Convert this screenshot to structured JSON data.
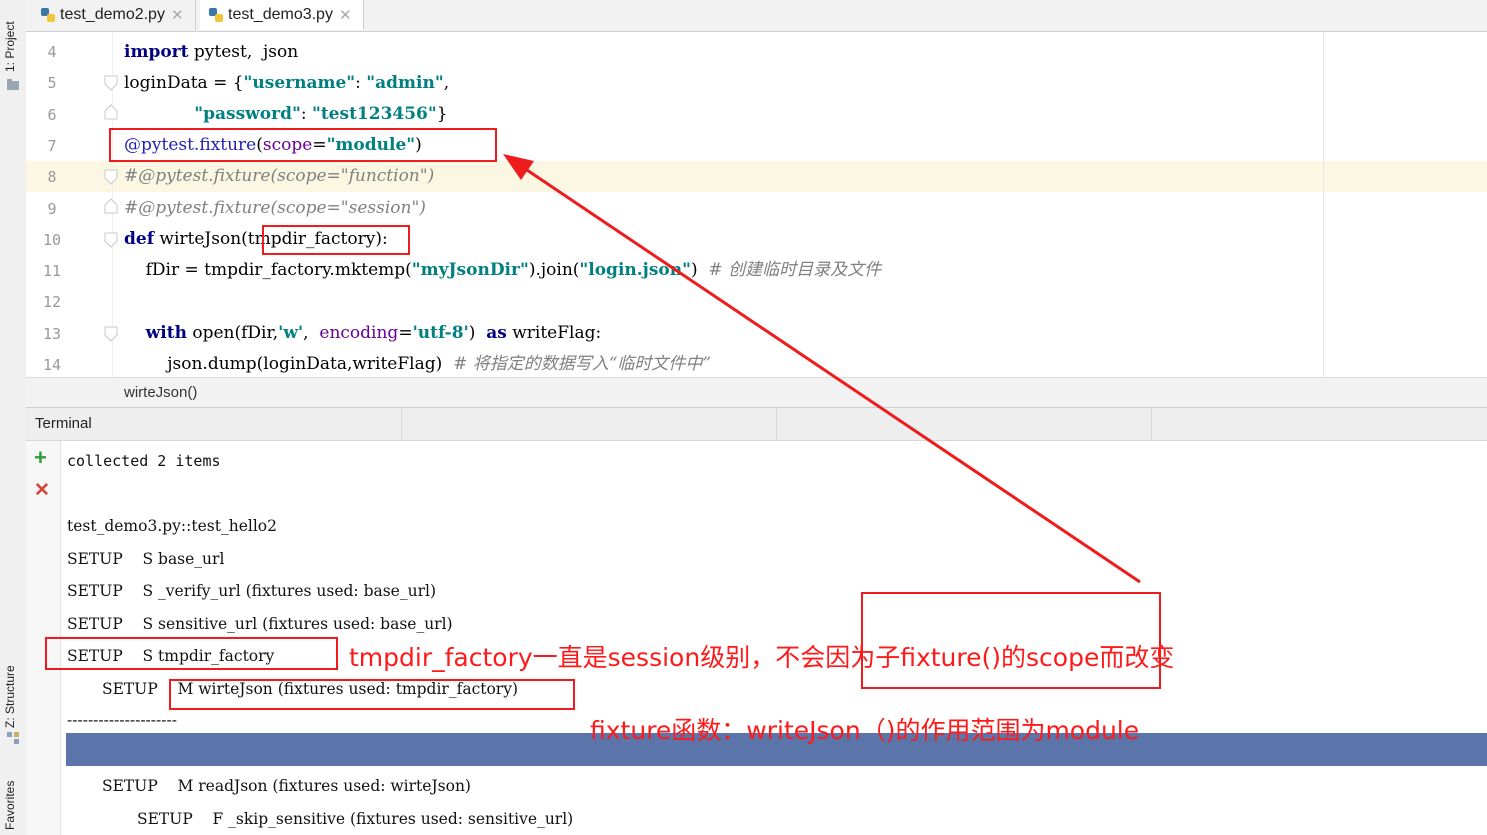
{
  "left_strip": {
    "project_tab": "1: Project",
    "structure_tab": "Z: Structure",
    "favorites_tab": "Favorites"
  },
  "tabs": [
    {
      "label": "test_demo2.py",
      "active": false
    },
    {
      "label": "test_demo3.py",
      "active": true
    }
  ],
  "editor": {
    "line_numbers": [
      "4",
      "5",
      "6",
      "7",
      "8",
      "9",
      "10",
      "11",
      "12",
      "13",
      "14"
    ],
    "lines": {
      "l4": {
        "kw": "import",
        "rest": " pytest,  json"
      },
      "l5": {
        "a": "loginData = {",
        "key": "\"username\"",
        "b": ": ",
        "val": "\"admin\"",
        "c": ","
      },
      "l6": {
        "indent": "             ",
        "key": "\"password\"",
        "b": ": ",
        "val": "\"test123456\"",
        "c": "}"
      },
      "l7": {
        "dec": "@pytest.fixture",
        "p1": "(",
        "prm": "scope",
        "eq": "=",
        "val": "\"module\"",
        "p2": ")"
      },
      "l8": "#@pytest.fixture(scope=\"function\")",
      "l9": "#@pytest.fixture(scope=\"session\")",
      "l10": {
        "kw": "def",
        "name": " wirteJson(",
        "arg": "tmpdir_factory",
        "end": "):"
      },
      "l11": {
        "a": "    fDir = tmpdir_factory.mktemp(",
        "s1": "\"myJsonDir\"",
        "b": ").join(",
        "s2": "\"login.json\"",
        "c": ")  ",
        "cmt": "# 创建临时目录及文件"
      },
      "l13": {
        "indent": "    ",
        "kw": "with",
        "a": " open(fDir,",
        "s1": "'w'",
        "b": ",  ",
        "prm": "encoding",
        "eq": "=",
        "s2": "'utf-8'",
        "c": ")  ",
        "kw2": "as",
        "d": " writeFlag:"
      },
      "l14": {
        "a": "        json.dump(loginData,writeFlag)  ",
        "cmt": "# 将指定的数据写入“临时文件中”"
      }
    },
    "breadcrumb": "wirteJson()"
  },
  "terminal": {
    "title": "Terminal",
    "add_icon": "+",
    "close_icon": "✕",
    "lines": [
      "collected 2 items",
      "test_demo3.py::test_hello2",
      "SETUP    S base_url",
      "SETUP    S _verify_url (fixtures used: base_url)",
      "SETUP    S sensitive_url (fixtures used: base_url)",
      "SETUP    S tmpdir_factory",
      "SETUP    M wirteJson (fixtures used: tmpdir_factory)",
      "---------------------",
      "SETUP    M readJson (fixtures used: wirteJson)",
      "SETUP    F _skip_sensitive (fixtures used: sensitive_url)"
    ]
  },
  "annotations": {
    "note1": "tmpdir_factory一直是session级别，不会因为子fixture()的scope而改变",
    "note2": "fixture函数：writeJson（)的作用范围为module",
    "color": "#ff1a1a"
  }
}
